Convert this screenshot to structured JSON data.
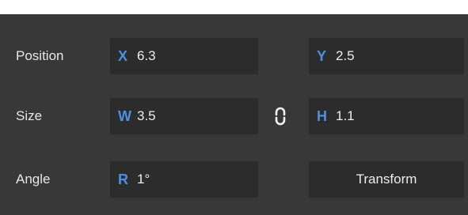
{
  "panel": {
    "position": {
      "label": "Position",
      "x": {
        "axis": "X",
        "value": "6.3"
      },
      "y": {
        "axis": "Y",
        "value": "2.5"
      }
    },
    "size": {
      "label": "Size",
      "w": {
        "axis": "W",
        "value": "3.5"
      },
      "h": {
        "axis": "H",
        "value": "1.1"
      },
      "link_icon": "chain-link-icon"
    },
    "angle": {
      "label": "Angle",
      "r": {
        "axis": "R",
        "value": "1°"
      },
      "transform_button": "Transform"
    }
  },
  "colors": {
    "panel_bg": "#383838",
    "field_bg": "#2c2c2c",
    "axis_accent": "#4f8fe0",
    "text": "#ececec"
  }
}
